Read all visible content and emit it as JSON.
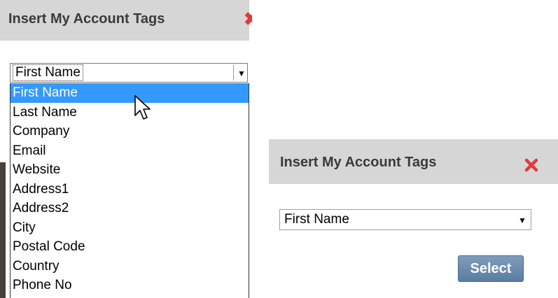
{
  "left_dialog": {
    "title": "Insert My Account Tags",
    "close_glyph": "✖",
    "select": {
      "value": "First Name",
      "arrow_glyph": "▼"
    },
    "options": [
      "First Name",
      "Last Name",
      "Company",
      "Email",
      "Website",
      "Address1",
      "Address2",
      "City",
      "Postal Code",
      "Country",
      "Phone No"
    ],
    "highlighted_option": "First Name"
  },
  "right_dialog": {
    "title": "Insert My Account Tags",
    "select": {
      "value": "First Name",
      "arrow_glyph": "▼"
    },
    "button_label": "Select"
  },
  "icons": {
    "close": "close-icon",
    "cursor": "mouse-pointer-icon"
  },
  "colors": {
    "header_bg": "#d6d6d6",
    "highlight": "#3399ff",
    "close_red": "#e03a3a",
    "button_blue": "#6b8bb0"
  }
}
